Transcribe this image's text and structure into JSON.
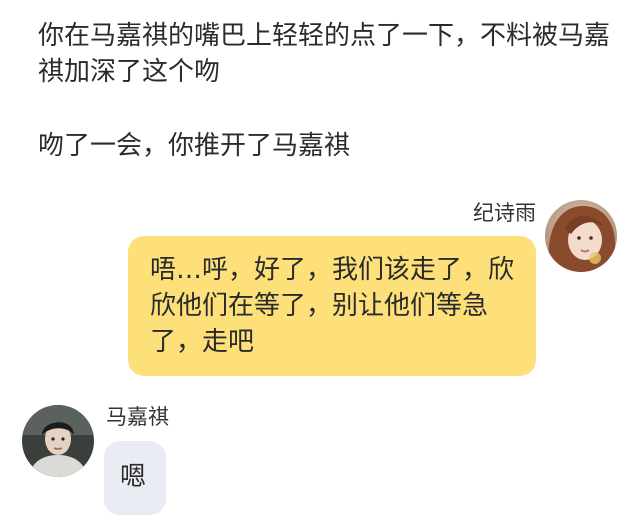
{
  "narration": {
    "line1": "你在马嘉祺的嘴巴上轻轻的点了一下，不料被马嘉祺加深了这个吻",
    "line2": "吻了一会，你推开了马嘉祺"
  },
  "messages": [
    {
      "side": "right",
      "sender": "纪诗雨",
      "text": "唔…呼，好了，我们该走了，欣欣他们在等了，别让他们等急了，走吧",
      "bubble_color": "#fde07a"
    },
    {
      "side": "left",
      "sender": "马嘉祺",
      "text": "嗯",
      "bubble_color": "#e9edf3"
    }
  ],
  "icons": {
    "avatar_right": "girl-portrait-avatar",
    "avatar_left": "boy-portrait-avatar"
  }
}
